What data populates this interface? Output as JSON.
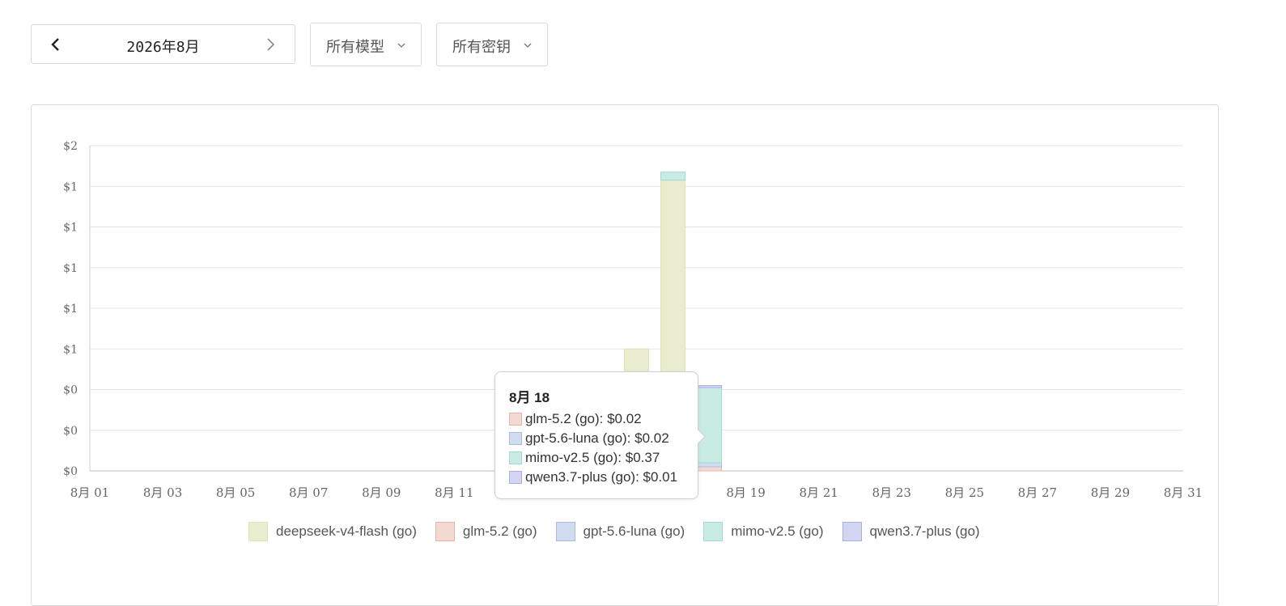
{
  "controls": {
    "month_label": "2026年8月",
    "model_select": "所有模型",
    "key_select": "所有密钥"
  },
  "tooltip": {
    "title": "8月 18",
    "rows": [
      {
        "series": "glm-5.2 (go)",
        "text": "glm-5.2 (go): $0.02"
      },
      {
        "series": "gpt-5.6-luna (go)",
        "text": "gpt-5.6-luna (go): $0.02"
      },
      {
        "series": "mimo-v2.5 (go)",
        "text": "mimo-v2.5 (go): $0.37"
      },
      {
        "series": "qwen3.7-plus (go)",
        "text": "qwen3.7-plus (go): $0.01"
      }
    ]
  },
  "chart_data": {
    "type": "bar",
    "stacked": true,
    "x_tick_labels": [
      "8月 01",
      "8月 03",
      "8月 05",
      "8月 07",
      "8月 09",
      "8月 11",
      "8月 13",
      "8月 15",
      "8月 17",
      "8月 19",
      "8月 21",
      "8月 23",
      "8月 25",
      "8月 27",
      "8月 29",
      "8月 31"
    ],
    "categories": [
      "8月 01",
      "8月 02",
      "8月 03",
      "8月 04",
      "8月 05",
      "8月 06",
      "8月 07",
      "8月 08",
      "8月 09",
      "8月 10",
      "8月 11",
      "8月 12",
      "8月 13",
      "8月 14",
      "8月 15",
      "8月 16",
      "8月 17",
      "8月 18",
      "8月 19",
      "8月 20",
      "8月 21",
      "8月 22",
      "8月 23",
      "8月 24",
      "8月 25",
      "8月 26",
      "8月 27",
      "8月 28",
      "8月 29",
      "8月 30",
      "8月 31"
    ],
    "y_tick_labels": [
      "$0",
      "$0",
      "$0",
      "$1",
      "$1",
      "$1",
      "$1",
      "$1",
      "$2"
    ],
    "ylim": [
      0,
      1.6
    ],
    "grid": true,
    "legend_position": "bottom",
    "series": [
      {
        "name": "deepseek-v4-flash (go)",
        "color": "#dfe4b6",
        "fill": "#e9ecce",
        "values": [
          0,
          0,
          0,
          0,
          0,
          0,
          0,
          0,
          0,
          0,
          0,
          0,
          0,
          0,
          0,
          0.6,
          1.43,
          0,
          0,
          0,
          0,
          0,
          0,
          0,
          0,
          0,
          0,
          0,
          0,
          0,
          0
        ]
      },
      {
        "name": "glm-5.2 (go)",
        "color": "#e8b5a8",
        "fill": "#f3d9d2",
        "values": [
          0,
          0,
          0,
          0,
          0,
          0,
          0,
          0,
          0,
          0,
          0,
          0,
          0,
          0,
          0,
          0,
          0,
          0.02,
          0,
          0,
          0,
          0,
          0,
          0,
          0,
          0,
          0,
          0,
          0,
          0,
          0
        ]
      },
      {
        "name": "gpt-5.6-luna (go)",
        "color": "#a9bde3",
        "fill": "#d2dcf1",
        "values": [
          0,
          0,
          0,
          0,
          0,
          0,
          0,
          0,
          0,
          0,
          0,
          0,
          0,
          0,
          0,
          0,
          0,
          0.02,
          0,
          0,
          0,
          0,
          0,
          0,
          0,
          0,
          0,
          0,
          0,
          0,
          0
        ]
      },
      {
        "name": "mimo-v2.5 (go)",
        "color": "#9fdcd0",
        "fill": "#c8ebe4",
        "values": [
          0,
          0,
          0,
          0,
          0,
          0,
          0,
          0,
          0,
          0,
          0,
          0,
          0,
          0,
          0,
          0,
          0.04,
          0.37,
          0,
          0,
          0,
          0,
          0,
          0,
          0,
          0,
          0,
          0,
          0,
          0,
          0
        ]
      },
      {
        "name": "qwen3.7-plus (go)",
        "color": "#a9afe6",
        "fill": "#d3d6f3",
        "values": [
          0,
          0,
          0,
          0,
          0,
          0,
          0,
          0,
          0,
          0,
          0,
          0,
          0,
          0,
          0,
          0,
          0,
          0.01,
          0,
          0,
          0,
          0,
          0,
          0,
          0,
          0,
          0,
          0,
          0,
          0,
          0
        ]
      }
    ]
  }
}
